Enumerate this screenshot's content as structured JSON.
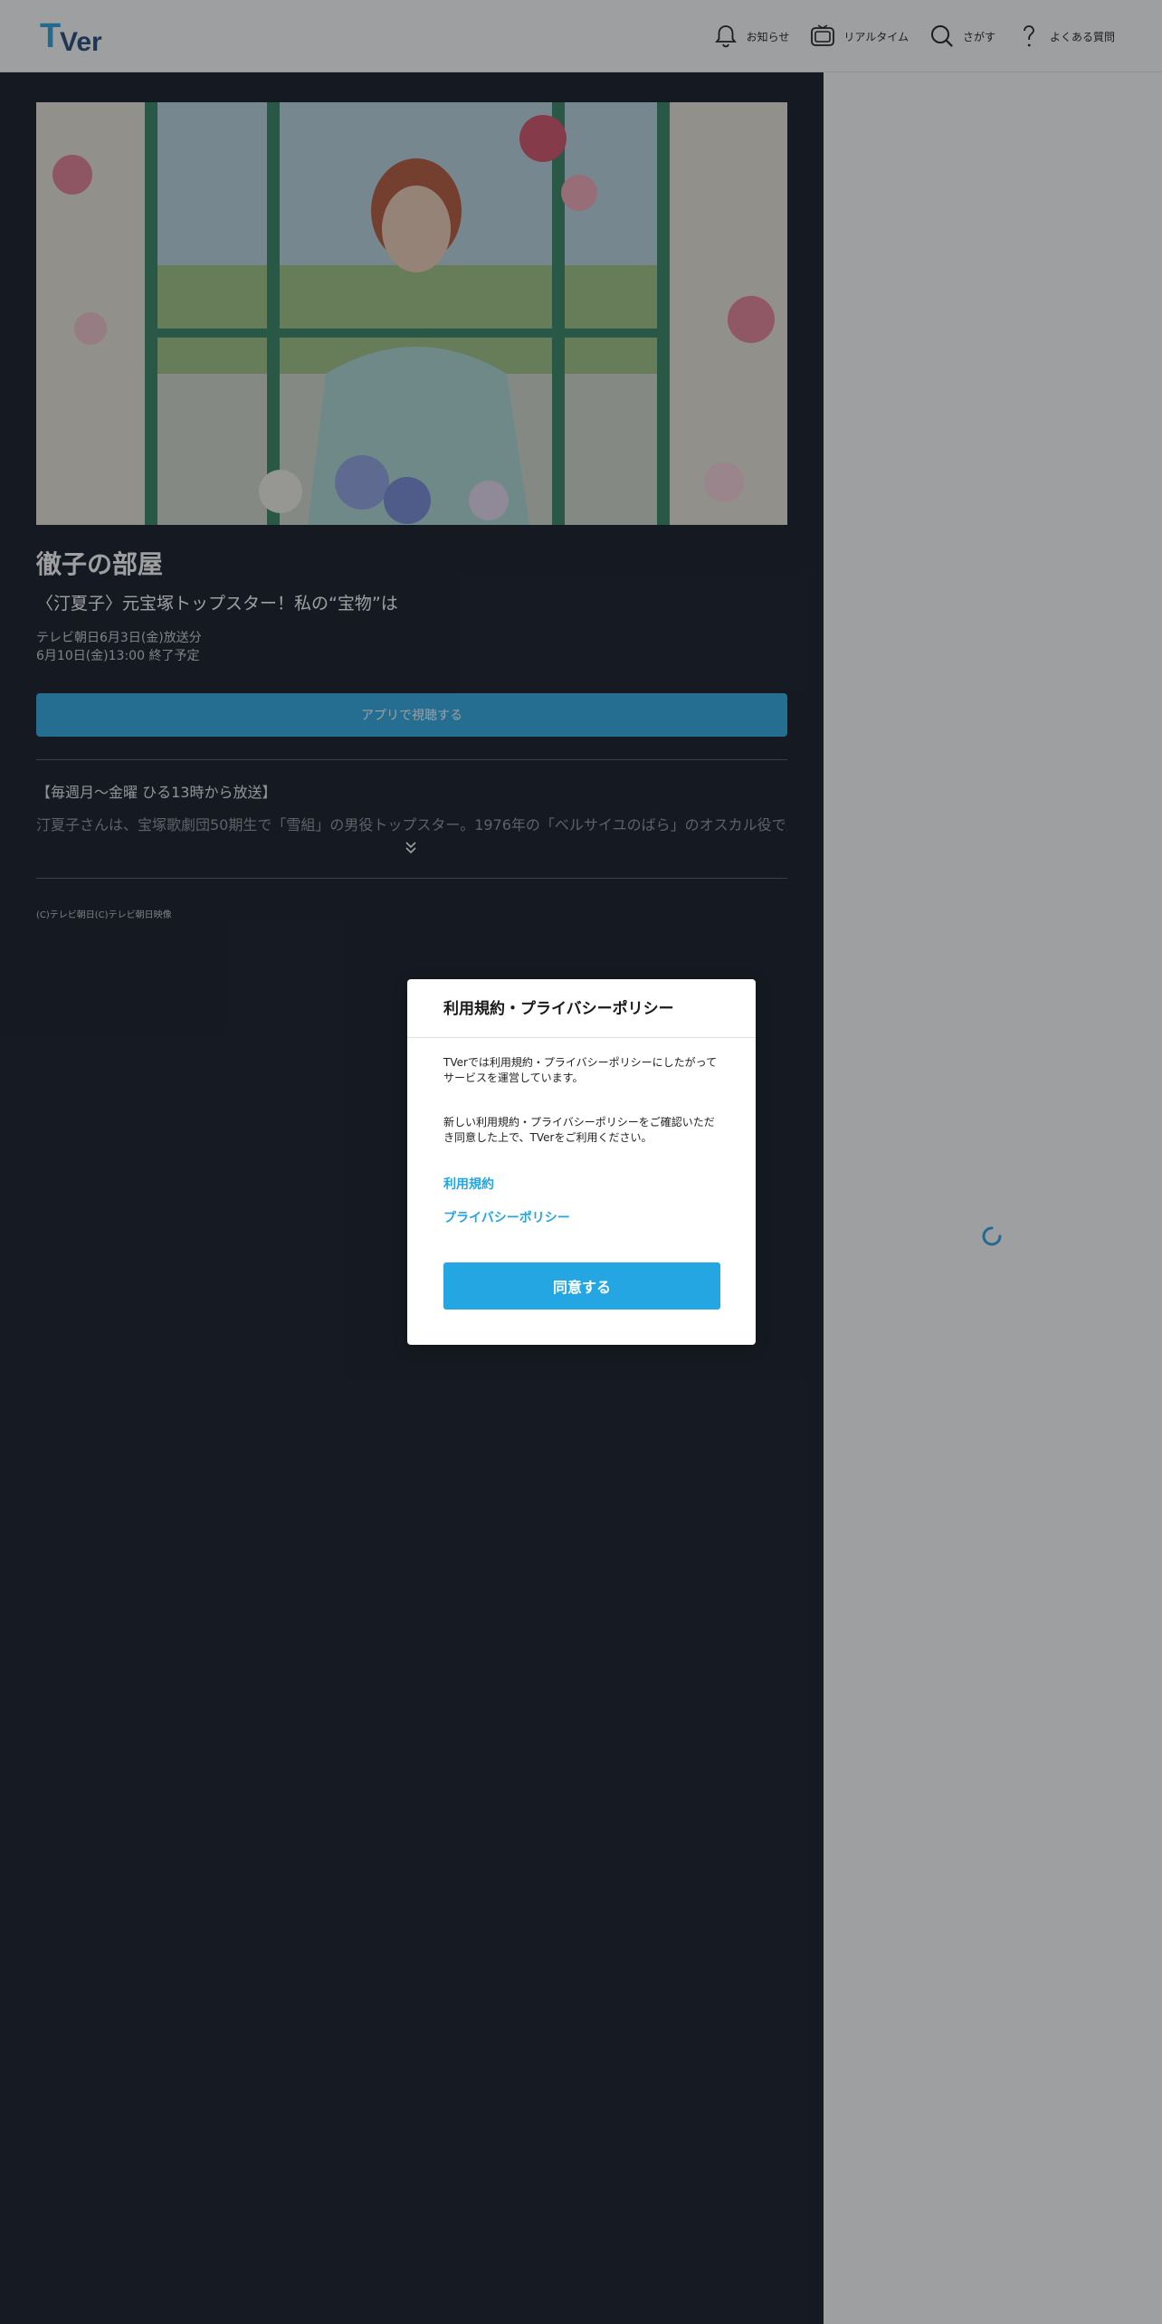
{
  "header": {
    "logo_text": "TVer",
    "nav": [
      {
        "label": "お知らせ",
        "icon": "bell-icon"
      },
      {
        "label": "リアルタイム",
        "icon": "tv-icon"
      },
      {
        "label": "さがす",
        "icon": "search-icon"
      },
      {
        "label": "よくある質問",
        "icon": "question-icon"
      }
    ]
  },
  "program": {
    "title": "徹子の部屋",
    "subtitle": "〈汀夏子〉元宝塚トップスター！私の“宝物”は",
    "broadcast": "テレビ朝日6月3日(金)放送分",
    "end": "6月10日(金)13:00 終了予定",
    "app_button": "アプリで視聴する",
    "description_head": "【毎週月～金曜 ひる13時から放送】",
    "description_body": "汀夏子さんは、宝塚歌劇団50期生で「雪組」の男役トップスター。1976年の「ベルサイユのばら」のオスカル役で人気を博",
    "copyright": "(C)テレビ朝日(C)テレビ朝日映像"
  },
  "modal": {
    "title": "利用規約・プライバシーポリシー",
    "paragraph1": "TVerでは利用規約・プライバシーポリシーにしたがってサービスを運営しています。",
    "paragraph2": "新しい利用規約・プライバシーポリシーをご確認いただき同意した上で、TVerをご利用ください。",
    "link_terms": "利用規約",
    "link_privacy": "プライバシーポリシー",
    "agree_button": "同意する"
  },
  "colors": {
    "accent": "#23a6e2",
    "dark_bg": "#070d19"
  }
}
